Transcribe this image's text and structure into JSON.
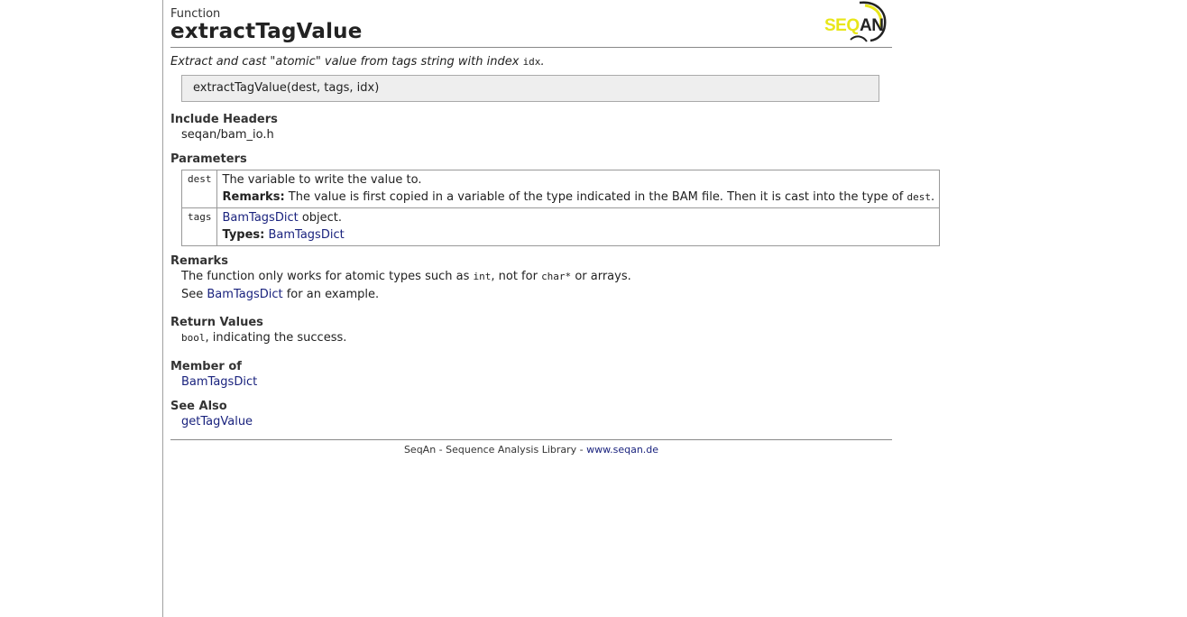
{
  "header": {
    "kind": "Function",
    "title": "extractTagValue",
    "logo_text": "SEQAN"
  },
  "summary": {
    "text": "Extract and cast \"atomic\" value from tags string with index",
    "code": "idx",
    "end": "."
  },
  "signature": "extractTagValue(dest, tags, idx)",
  "include_headers": {
    "title": "Include Headers",
    "value": "seqan/bam_io.h"
  },
  "parameters": {
    "title": "Parameters",
    "items": [
      {
        "name": "dest",
        "description": "The variable to write the value to.",
        "remarks_label": "Remarks:",
        "remarks_text": "The value is first copied in a variable of the type indicated in the BAM file. Then it is cast into the type of",
        "remarks_code": "dest",
        "remarks_end": "."
      },
      {
        "name": "tags",
        "link": "BamTagsDict",
        "description_rest": " object.",
        "types_label": "Types:",
        "types_link": "BamTagsDict"
      }
    ]
  },
  "remarks": {
    "title": "Remarks",
    "line1_a": "The function only works for atomic types such as",
    "line1_code1": "int",
    "line1_b": ", not for",
    "line1_code2": "char*",
    "line1_c": "or arrays.",
    "line2_a": "See",
    "line2_link": "BamTagsDict",
    "line2_b": "for an example."
  },
  "return_values": {
    "title": "Return Values",
    "code": "bool",
    "text": ", indicating the success."
  },
  "member_of": {
    "title": "Member of",
    "link": "BamTagsDict"
  },
  "see_also": {
    "title": "See Also",
    "link": "getTagValue"
  },
  "footer": {
    "text": "SeqAn - Sequence Analysis Library -",
    "link": "www.seqan.de"
  }
}
